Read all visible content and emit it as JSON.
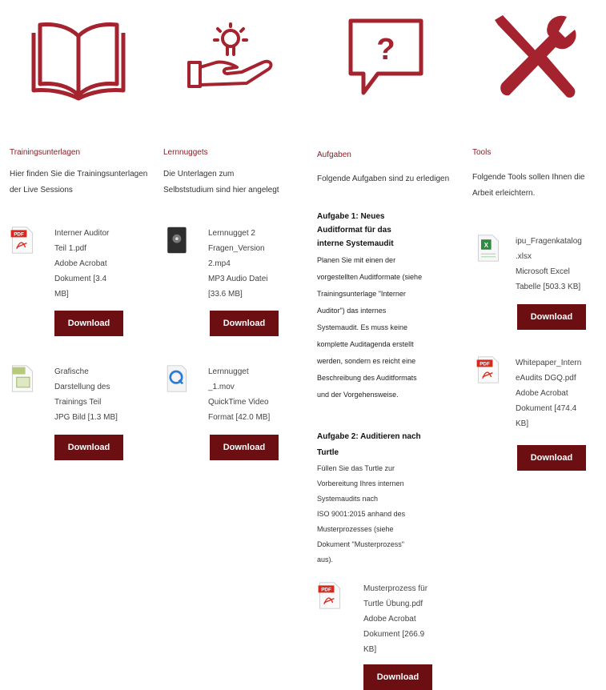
{
  "colors": {
    "accent": "#a5232e",
    "button": "#6b0f12",
    "heading": "#8b1c24"
  },
  "columns": [
    {
      "heading": "Trainingsunterlagen",
      "icon": "open-book-icon",
      "intro": "Hier finden Sie die Trainingsunterlagen der Live Sessions",
      "files": [
        {
          "icon": "pdf-file-icon",
          "lines": [
            "Interner Auditor",
            "Teil 1.pdf",
            "Adobe Acrobat",
            "Dokument [3.4",
            "MB]"
          ],
          "button": "Download"
        },
        {
          "icon": "image-file-icon",
          "lines": [
            "Grafische",
            "Darstellung des",
            "Trainings Teil",
            "JPG Bild [1.3 MB]"
          ],
          "button": "Download"
        }
      ]
    },
    {
      "heading": "Lernnuggets",
      "icon": "hand-lightbulb-icon",
      "intro": "Die Unterlagen zum Selbststudium sind hier angelegt",
      "files": [
        {
          "icon": "audio-file-icon",
          "lines": [
            "Lernnugget 2",
            "Fragen_Version",
            "2.mp4",
            "MP3 Audio Datei",
            "[33.6 MB]"
          ],
          "button": "Download"
        },
        {
          "icon": "quicktime-file-icon",
          "lines": [
            "Lernnugget",
            "_1.mov",
            "QuickTime Video",
            "Format [42.0 MB]"
          ],
          "button": "Download"
        }
      ]
    },
    {
      "heading": "Aufgaben",
      "icon": "question-bubble-icon",
      "intro": "Folgende Aufgaben sind zu erledigen",
      "task1_title": [
        "Aufgabe 1:  Neues",
        "Auditformat für das",
        "interne Systemaudit"
      ],
      "task1_body": [
        "Planen Sie mit einen der",
        "vorgestellten Auditformate (siehe",
        "Trainingsunterlage \"Interner",
        "Auditor\") das  internes",
        "Systemaudit. Es muss keine",
        "komplette Auditagenda erstellt",
        "werden, sondern es reicht eine",
        "Beschreibung des Auditformats",
        "und der Vorgehensweise."
      ],
      "task2_title": [
        "Aufgabe 2: Auditieren nach",
        "Turtle"
      ],
      "task2_body": [
        "Füllen Sie das Turtle zur",
        "Vorbereitung Ihres internen",
        "Systemaudits nach",
        "ISO 9001:2015 anhand des",
        "Musterprozesses (siehe",
        "Dokument \"Musterprozess\"",
        "aus)."
      ],
      "files": [
        {
          "icon": "pdf-file-icon",
          "lines": [
            "Musterprozess für",
            "Turtle Übung.pdf",
            "Adobe Acrobat",
            "Dokument [266.9",
            "KB]"
          ],
          "button": "Download"
        }
      ]
    },
    {
      "heading": "Tools",
      "icon": "tools-icon",
      "intro": "Folgende Tools sollen Ihnen die Arbeit erleichtern.",
      "files": [
        {
          "icon": "excel-file-icon",
          "lines": [
            "ipu_Fragenkatalog",
            ".xlsx",
            "Microsoft Excel",
            "Tabelle [503.3 KB]"
          ],
          "button": "Download"
        },
        {
          "icon": "pdf-file-icon",
          "lines": [
            "Whitepaper_Intern",
            "eAudits DGQ.pdf",
            "Adobe Acrobat",
            "Dokument [474.4",
            "KB]"
          ],
          "button": "Download"
        }
      ]
    }
  ]
}
